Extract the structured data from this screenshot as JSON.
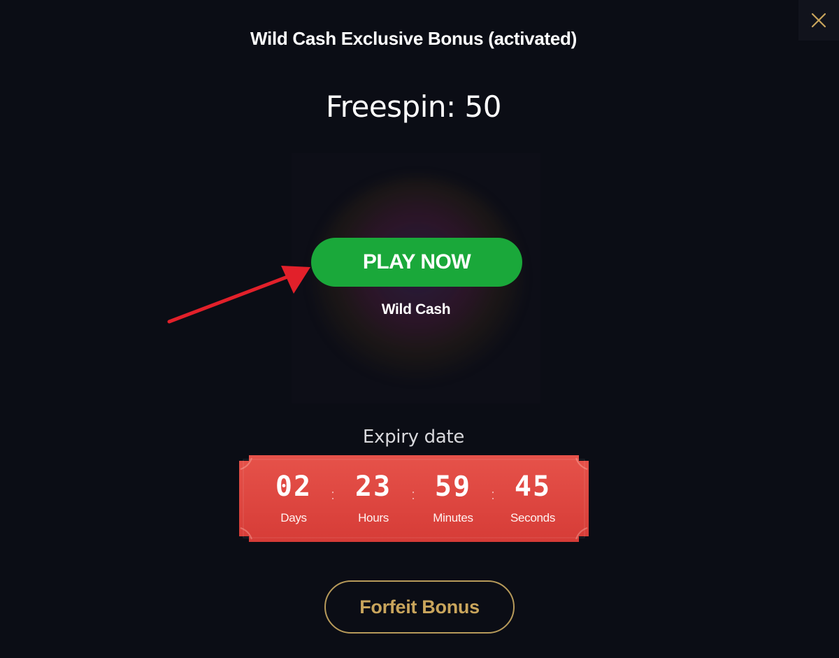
{
  "modal": {
    "title": "Wild Cash Exclusive Bonus (activated)",
    "freespin_text": "Freespin: 50",
    "close_icon": "close-icon"
  },
  "game": {
    "play_label": "PLAY NOW",
    "name": "Wild Cash"
  },
  "expiry": {
    "label": "Expiry date",
    "days": {
      "value": "02",
      "label": "Days"
    },
    "hours": {
      "value": "23",
      "label": "Hours"
    },
    "minutes": {
      "value": "59",
      "label": "Minutes"
    },
    "seconds": {
      "value": "45",
      "label": "Seconds"
    },
    "separator": ":"
  },
  "actions": {
    "forfeit_label": "Forfeit Bonus"
  },
  "colors": {
    "background": "#0b0d15",
    "play_button": "#1aa83a",
    "countdown": "#e0463f",
    "forfeit_border": "#b79a5a",
    "forfeit_text": "#c9a55c",
    "close_icon": "#c9a55c",
    "annotation_arrow": "#e2202a"
  }
}
